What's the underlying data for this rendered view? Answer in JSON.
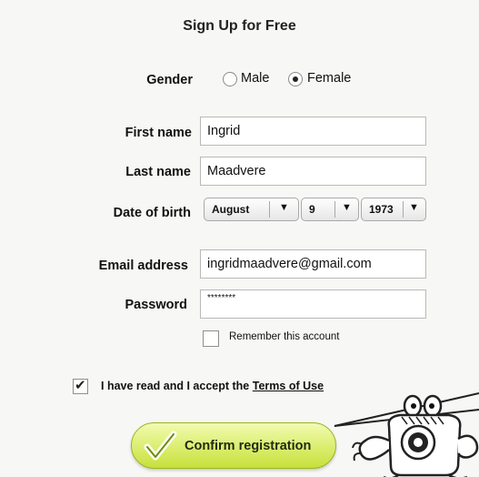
{
  "form": {
    "title": "Sign Up for Free",
    "gender": {
      "label": "Gender",
      "options": [
        "Male",
        "Female"
      ],
      "selected": "Female"
    },
    "first_name": {
      "label": "First name",
      "value": "Ingrid"
    },
    "last_name": {
      "label": "Last name",
      "value": "Maadvere"
    },
    "dob": {
      "label": "Date of birth",
      "month": "August",
      "day": "9",
      "year": "1973"
    },
    "email": {
      "label": "Email address",
      "value": "ingridmaadvere@gmail.com"
    },
    "password": {
      "label": "Password",
      "value": "********"
    },
    "remember": {
      "label": "Remember this account",
      "checked": false
    },
    "terms": {
      "prefix": "I have read and I accept the",
      "link": "Terms of Use",
      "checked": true
    },
    "confirm_label": "Confirm registration"
  },
  "icons": {
    "check": "checkmark-icon",
    "arrow": "triangle-down-icon",
    "mascot": "camera-mascot-icon"
  },
  "colors": {
    "button_top": "#f2fbb0",
    "button_bottom": "#c7e03a",
    "button_border": "#9ab51e"
  }
}
